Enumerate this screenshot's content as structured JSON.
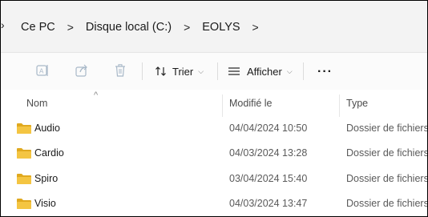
{
  "breadcrumb": {
    "items": [
      "Ce PC",
      "Disque local (C:)",
      "EOLYS"
    ],
    "separator": ">"
  },
  "toolbar": {
    "icons": [
      "rename-icon",
      "share-icon",
      "delete-icon"
    ],
    "sort_label": "Trier",
    "view_label": "Afficher",
    "more_label": "···"
  },
  "columns": {
    "name": "Nom",
    "modified": "Modifié le",
    "type": "Type"
  },
  "files": [
    {
      "name": "Audio",
      "modified": "04/04/2024 10:50",
      "type": "Dossier de fichiers"
    },
    {
      "name": "Cardio",
      "modified": "04/03/2024 13:28",
      "type": "Dossier de fichiers"
    },
    {
      "name": "Spiro",
      "modified": "03/04/2024 15:40",
      "type": "Dossier de fichiers"
    },
    {
      "name": "Visio",
      "modified": "04/03/2024 13:47",
      "type": "Dossier de fichiers"
    }
  ],
  "colors": {
    "folder": "#f4c542",
    "folder_dark": "#e0a91f",
    "icon_disabled": "#a8b8c8"
  }
}
